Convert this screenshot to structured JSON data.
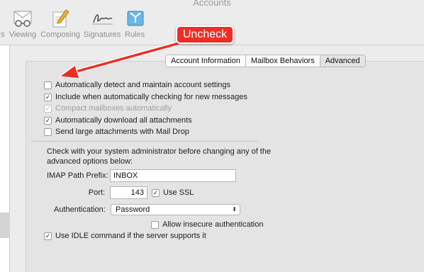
{
  "window": {
    "title": "Accounts"
  },
  "toolbar": {
    "items": [
      {
        "label": "rs",
        "icon": "accounts-icon"
      },
      {
        "label": "Viewing",
        "icon": "glasses-icon"
      },
      {
        "label": "Composing",
        "icon": "pencil-note-icon"
      },
      {
        "label": "Signatures",
        "icon": "signature-icon"
      },
      {
        "label": "Rules",
        "icon": "rules-icon"
      }
    ]
  },
  "annotation": {
    "callout": "Uncheck",
    "color": "#ee2e24"
  },
  "tabs": [
    {
      "label": "Account Information",
      "active": false
    },
    {
      "label": "Mailbox Behaviors",
      "active": false
    },
    {
      "label": "Advanced",
      "active": true
    }
  ],
  "options": [
    {
      "label": "Automatically detect and maintain account settings",
      "checked": false,
      "enabled": true
    },
    {
      "label": "Include when automatically checking for new messages",
      "checked": true,
      "enabled": true
    },
    {
      "label": "Compact mailboxes automatically",
      "checked": true,
      "enabled": false
    },
    {
      "label": "Automatically download all attachments",
      "checked": true,
      "enabled": true
    },
    {
      "label": "Send large attachments with Mail Drop",
      "checked": false,
      "enabled": true
    }
  ],
  "advanced": {
    "note": "Check with your system administrator before changing any of the advanced options below:",
    "imap_prefix_label": "IMAP Path Prefix:",
    "imap_prefix_value": "INBOX",
    "port_label": "Port:",
    "port_value": "143",
    "use_ssl_label": "Use SSL",
    "use_ssl_checked": true,
    "auth_label": "Authentication:",
    "auth_value": "Password",
    "allow_insecure_label": "Allow insecure authentication",
    "allow_insecure_checked": false,
    "idle_label": "Use IDLE command if the server supports it",
    "idle_checked": true
  },
  "glyphs": {
    "check": "✓",
    "select_arrow": "⬍"
  }
}
